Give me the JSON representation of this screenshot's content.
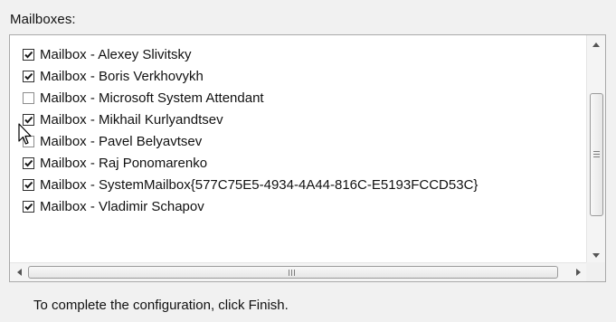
{
  "mailboxes_label": "Mailboxes:",
  "items": [
    {
      "label": "Mailbox - Alexey Slivitsky",
      "checked": true
    },
    {
      "label": "Mailbox - Boris Verkhovykh",
      "checked": true
    },
    {
      "label": "Mailbox - Microsoft System Attendant",
      "checked": false
    },
    {
      "label": "Mailbox - Mikhail Kurlyandtsev",
      "checked": true
    },
    {
      "label": "Mailbox - Pavel Belyavtsev",
      "checked": false
    },
    {
      "label": "Mailbox - Raj Ponomarenko",
      "checked": true
    },
    {
      "label": "Mailbox - SystemMailbox{577C75E5-4934-4A44-816C-E5193FCCD53C}",
      "checked": true
    },
    {
      "label": "Mailbox - Vladimir Schapov",
      "checked": true
    }
  ],
  "footer": "To complete the configuration, click Finish.",
  "colors": {
    "check": "#1a1a1a",
    "arrow": "#555555"
  }
}
